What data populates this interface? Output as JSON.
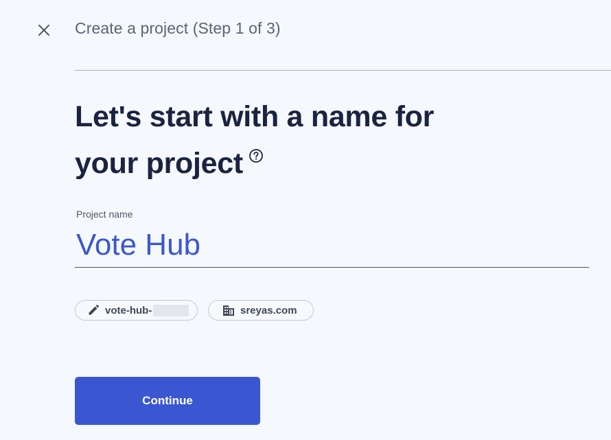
{
  "header": {
    "close_icon": "close-icon",
    "title": "Create a project (Step 1 of 3)"
  },
  "main": {
    "heading_line1": "Let's start with a name for",
    "heading_line2": "your project",
    "help_icon": "help-circle-icon",
    "project_name_label": "Project name",
    "project_name_value": "Vote Hub"
  },
  "chips": {
    "project_id": {
      "icon": "pencil-icon",
      "label": "vote-hub-"
    },
    "organization": {
      "icon": "building-icon",
      "label": "sreyas.com"
    }
  },
  "actions": {
    "continue_label": "Continue"
  },
  "colors": {
    "accent": "#3a57d1",
    "background": "#f5f8fd",
    "heading": "#1a2340"
  }
}
